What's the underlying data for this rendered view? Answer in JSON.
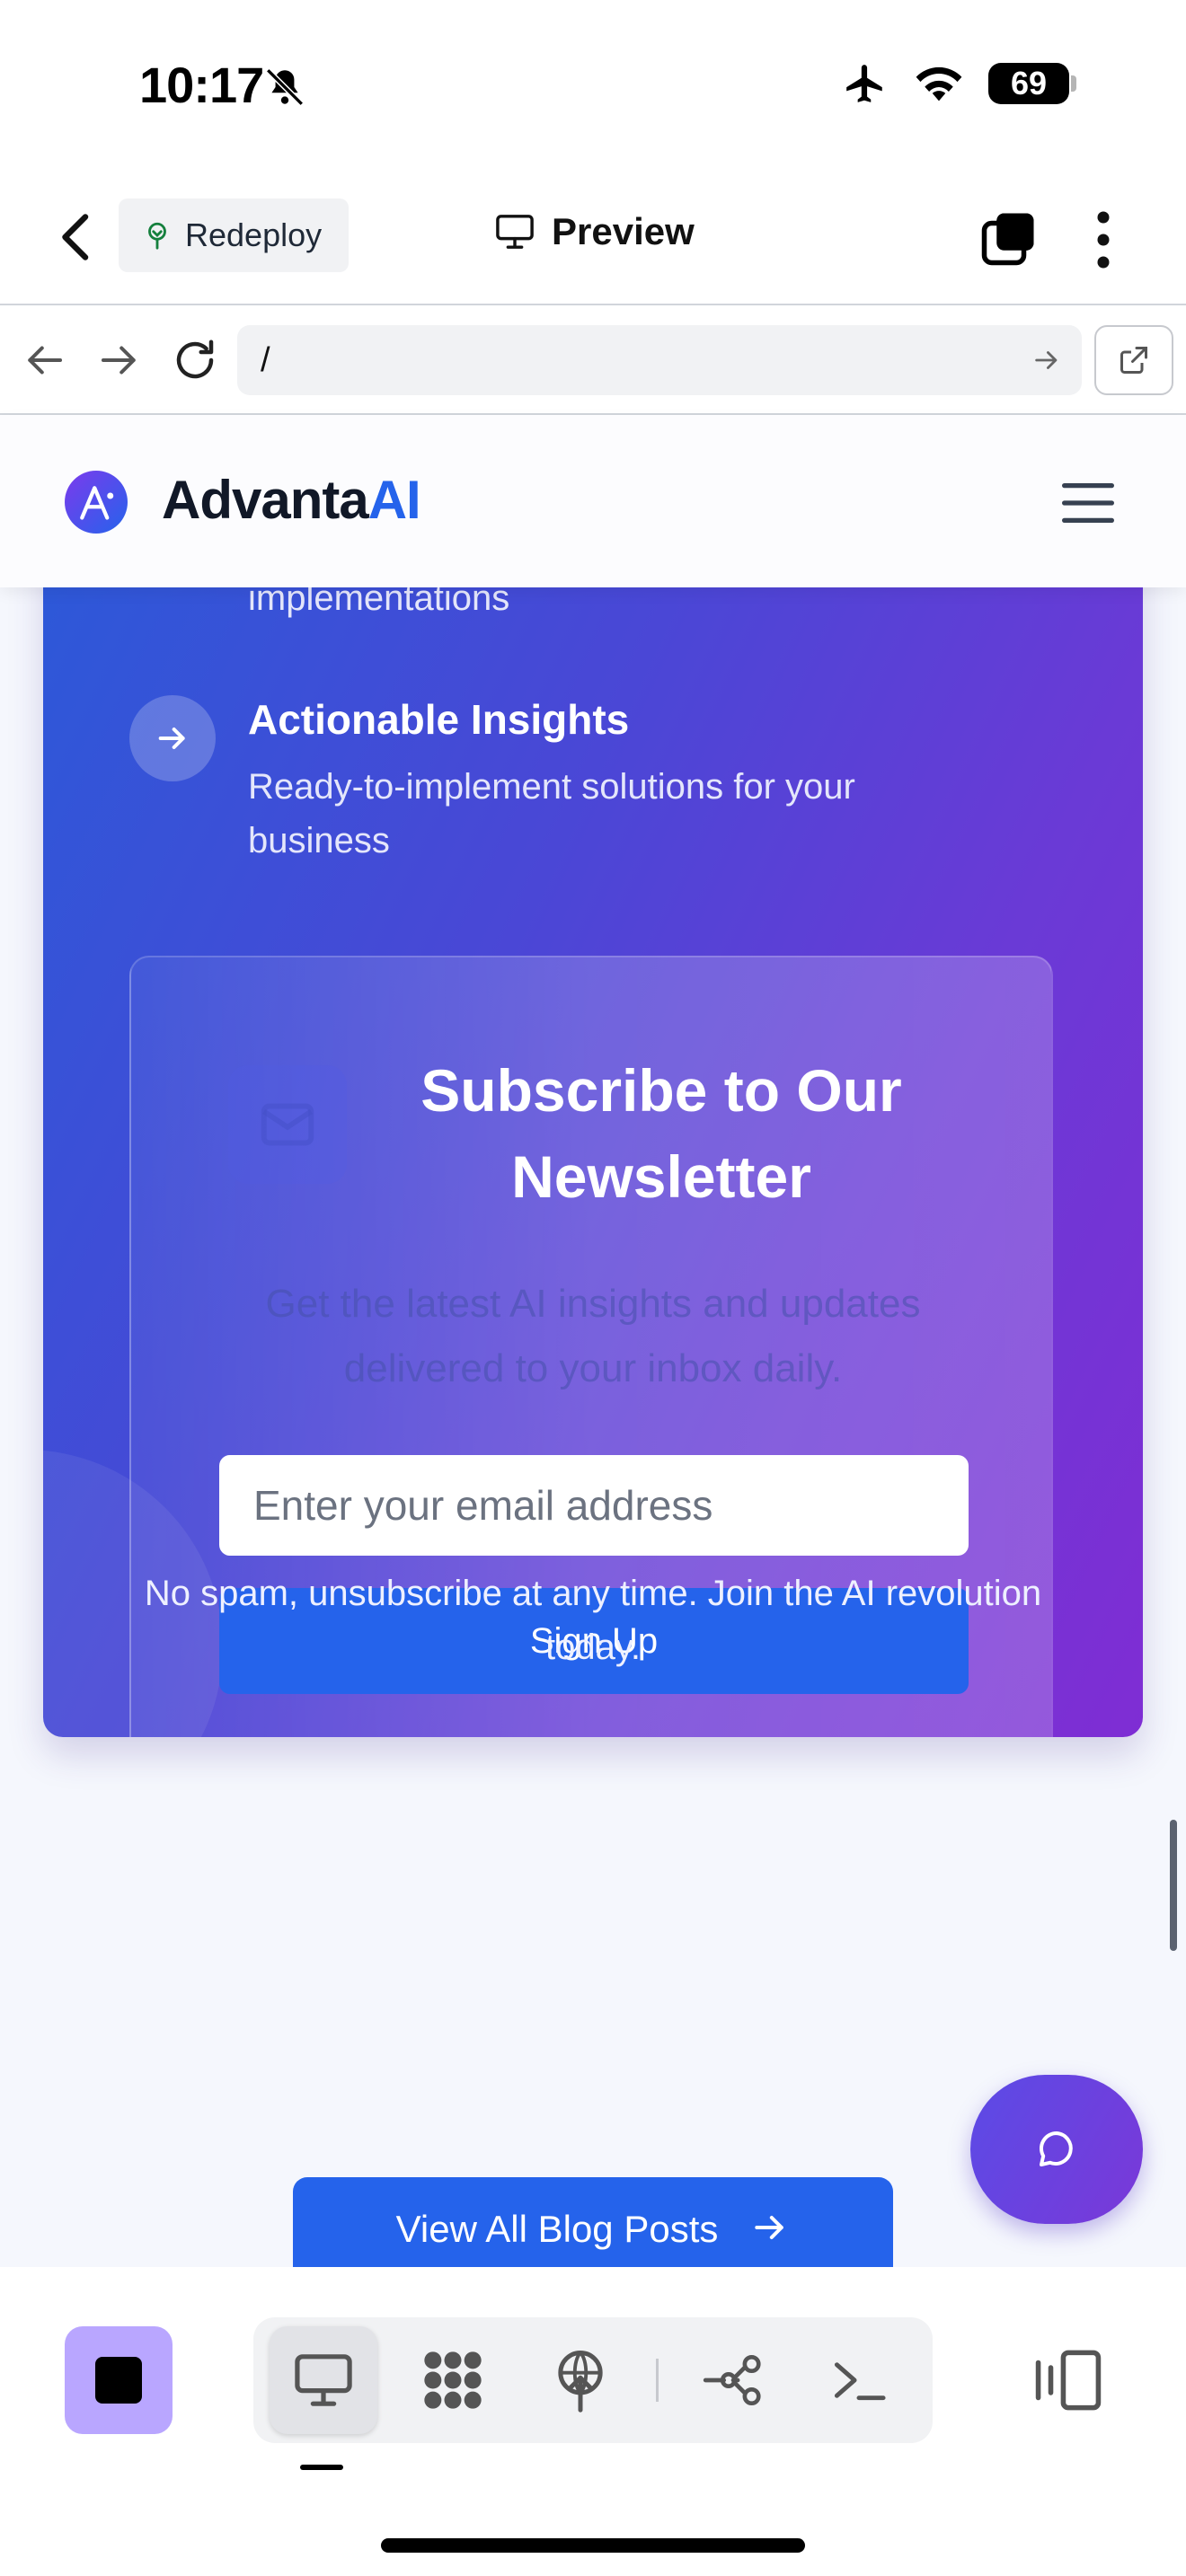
{
  "status_bar": {
    "time": "10:17",
    "battery": "69"
  },
  "app_header": {
    "redeploy_label": "Redeploy",
    "preview_label": "Preview"
  },
  "browser": {
    "url": "/"
  },
  "site_nav": {
    "logo_main": "Advanta",
    "logo_accent": "AI"
  },
  "features": {
    "prev_item_tail": "implementations",
    "item_title": "Actionable Insights",
    "item_desc": "Ready-to-implement solutions for your business"
  },
  "newsletter": {
    "title": "Subscribe to Our Newsletter",
    "description": "Get the latest AI insights and updates delivered to your inbox daily.",
    "email_placeholder": "Enter your email address",
    "button_label": "Sign Up",
    "fine_print": "No spam, unsubscribe at any time. Join the AI revolution today."
  },
  "blog": {
    "view_all_label": "View All Blog Posts"
  },
  "colors": {
    "accent": "#2563eb",
    "gradient_start": "#2c59d8",
    "gradient_end": "#7f2dd4",
    "stop_button": "#b9a6ff"
  },
  "icons": {
    "status": [
      "bell-slash-icon",
      "airplane-icon",
      "wifi-icon",
      "battery-icon"
    ],
    "toolbar": [
      "desktop-icon",
      "modules-icon",
      "deploy-icon",
      "branch-icon",
      "terminal-icon",
      "panel-toggle-icon"
    ]
  }
}
